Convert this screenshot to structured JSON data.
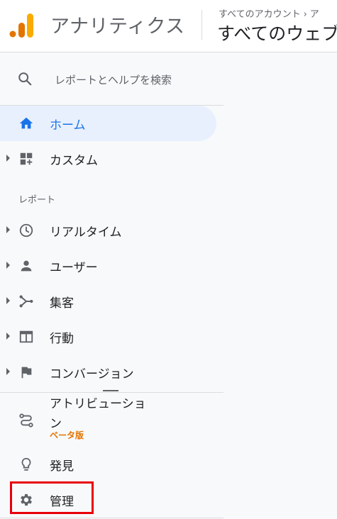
{
  "header": {
    "app_title": "アナリティクス",
    "breadcrumb": {
      "account": "すべてのアカウント",
      "chevron": "›",
      "next": "ア"
    },
    "property": "すべてのウェブ"
  },
  "sidebar": {
    "search_placeholder": "レポートとヘルプを検索",
    "home": "ホーム",
    "custom": "カスタム",
    "reports_section": "レポート",
    "reports": [
      {
        "label": "リアルタイム",
        "icon": "clock-icon"
      },
      {
        "label": "ユーザー",
        "icon": "person-icon"
      },
      {
        "label": "集客",
        "icon": "acquisition-icon"
      },
      {
        "label": "行動",
        "icon": "behavior-icon"
      },
      {
        "label": "コンバージョン",
        "icon": "flag-icon"
      }
    ],
    "attribution": {
      "label": "アトリビューション",
      "badge": "ベータ版"
    },
    "discover": "発見",
    "admin": "管理"
  },
  "colors": {
    "accent": "#1a73e8",
    "active_bg": "#e8f0fe",
    "beta": "#e37400",
    "highlight_box": "#e8000b",
    "logo_dark": "#e37400",
    "logo_light": "#f9ab00"
  }
}
